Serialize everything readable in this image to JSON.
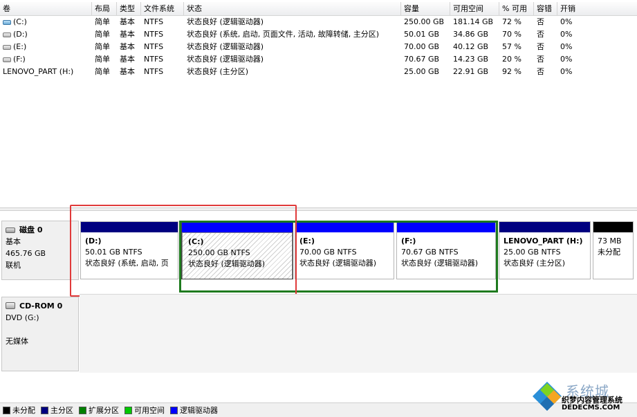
{
  "columns": [
    "卷",
    "布局",
    "类型",
    "文件系统",
    "状态",
    "容量",
    "可用空间",
    "% 可用",
    "容错",
    "开销"
  ],
  "volumes": [
    {
      "icon": "system-drive-icon",
      "name": "(C:)",
      "layout": "简单",
      "type": "基本",
      "fs": "NTFS",
      "status": "状态良好 (逻辑驱动器)",
      "capacity": "250.00 GB",
      "free": "181.14 GB",
      "pct": "72 %",
      "fault": "否",
      "overhead": "0%"
    },
    {
      "icon": "drive-icon",
      "name": "(D:)",
      "layout": "简单",
      "type": "基本",
      "fs": "NTFS",
      "status": "状态良好 (系统, 启动, 页面文件, 活动, 故障转储, 主分区)",
      "capacity": "50.01 GB",
      "free": "34.86 GB",
      "pct": "70 %",
      "fault": "否",
      "overhead": "0%"
    },
    {
      "icon": "drive-icon",
      "name": "(E:)",
      "layout": "简单",
      "type": "基本",
      "fs": "NTFS",
      "status": "状态良好 (逻辑驱动器)",
      "capacity": "70.00 GB",
      "free": "40.12 GB",
      "pct": "57 %",
      "fault": "否",
      "overhead": "0%"
    },
    {
      "icon": "drive-icon",
      "name": "(F:)",
      "layout": "简单",
      "type": "基本",
      "fs": "NTFS",
      "status": "状态良好 (逻辑驱动器)",
      "capacity": "70.67 GB",
      "free": "14.23 GB",
      "pct": "20 %",
      "fault": "否",
      "overhead": "0%"
    },
    {
      "icon": "none",
      "name": "LENOVO_PART (H:)",
      "layout": "简单",
      "type": "基本",
      "fs": "NTFS",
      "status": "状态良好 (主分区)",
      "capacity": "25.00 GB",
      "free": "22.91 GB",
      "pct": "92 %",
      "fault": "否",
      "overhead": "0%"
    }
  ],
  "disk0": {
    "name": "磁盘 0",
    "type": "基本",
    "size": "465.76 GB",
    "state": "联机",
    "partitions": [
      {
        "title": "(D:)",
        "size": "50.01 GB NTFS",
        "status": "状态良好 (系统, 启动, 页",
        "kind": "primary"
      },
      {
        "title": "(C:)",
        "size": "250.00 GB NTFS",
        "status": "状态良好 (逻辑驱动器)",
        "kind": "logical-selected"
      },
      {
        "title": "(E:)",
        "size": "70.00 GB NTFS",
        "status": "状态良好 (逻辑驱动器)",
        "kind": "logical"
      },
      {
        "title": "(F:)",
        "size": "70.67 GB NTFS",
        "status": "状态良好 (逻辑驱动器)",
        "kind": "logical"
      },
      {
        "title": "LENOVO_PART  (H:)",
        "size": "25.00 GB NTFS",
        "status": "状态良好 (主分区)",
        "kind": "primary"
      },
      {
        "title": "",
        "size": "73 MB",
        "status": "未分配",
        "kind": "unallocated"
      }
    ]
  },
  "cdrom0": {
    "name": "CD-ROM 0",
    "drive": "DVD (G:)",
    "media": "无媒体"
  },
  "legend": [
    {
      "label": "未分配",
      "color": "#000000"
    },
    {
      "label": "主分区",
      "color": "#000080"
    },
    {
      "label": "扩展分区",
      "color": "#008000"
    },
    {
      "label": "可用空间",
      "color": "#00c800"
    },
    {
      "label": "逻辑驱动器",
      "color": "#0000ff"
    }
  ],
  "colors": {
    "primary": "#000080",
    "logical": "#0000ff",
    "unallocated": "#000000",
    "extended_border": "#1e7a1e",
    "annotation_red": "#e03a3a"
  },
  "watermark": {
    "line1": "系统城",
    "line2": "织梦内容管理系统",
    "line3": "DEDECMS.COM"
  }
}
